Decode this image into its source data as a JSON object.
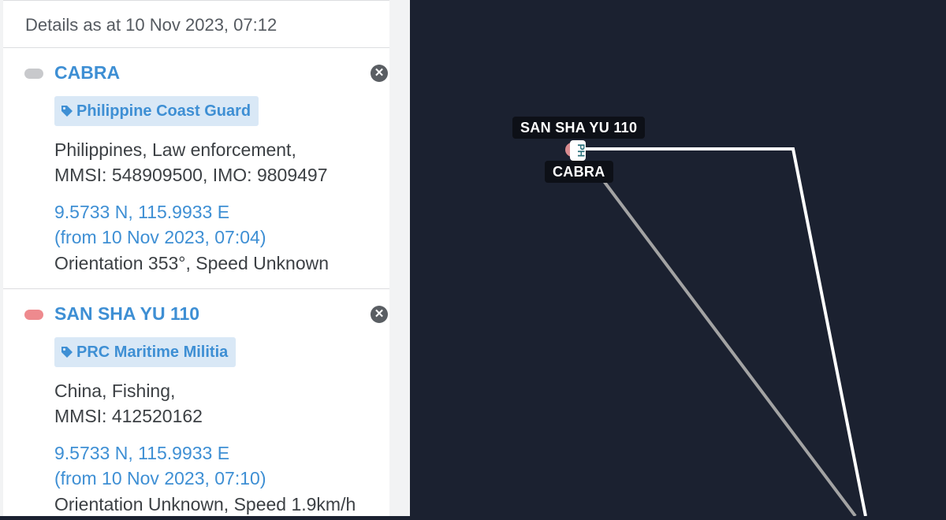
{
  "details": {
    "as_at": "Details as at 10 Nov 2023, 07:12"
  },
  "vessels": [
    {
      "name": "CABRA",
      "dot_color": "#c8c9cc",
      "tag": "Philippine Coast Guard",
      "line1": "Philippines, Law enforcement,",
      "line2": "MMSI: 548909500, IMO: 9809497",
      "coords": "9.5733 N, 115.9933 E",
      "from": "(from 10 Nov 2023, 07:04)",
      "status": "Orientation 353°, Speed Unknown",
      "close_icon": "close-circle-icon"
    },
    {
      "name": "SAN SHA YU 110",
      "dot_color": "#ee8a8e",
      "tag": "PRC Maritime Militia",
      "line1": "China, Fishing,",
      "line2": "MMSI: 412520162",
      "coords": "9.5733 N, 115.9933 E",
      "from": "(from 10 Nov 2023, 07:10)",
      "status": "Orientation Unknown, Speed 1.9km/h",
      "close_icon": "close-circle-icon"
    }
  ],
  "map": {
    "labels": {
      "top": "SAN SHA YU 110",
      "bottom": "CABRA"
    },
    "marker_text": "PH",
    "colors": {
      "background": "#1b2130",
      "track_white": "#ffffff",
      "track_grey": "#a3a3a3",
      "marker_pink": "#d98b8f"
    }
  }
}
